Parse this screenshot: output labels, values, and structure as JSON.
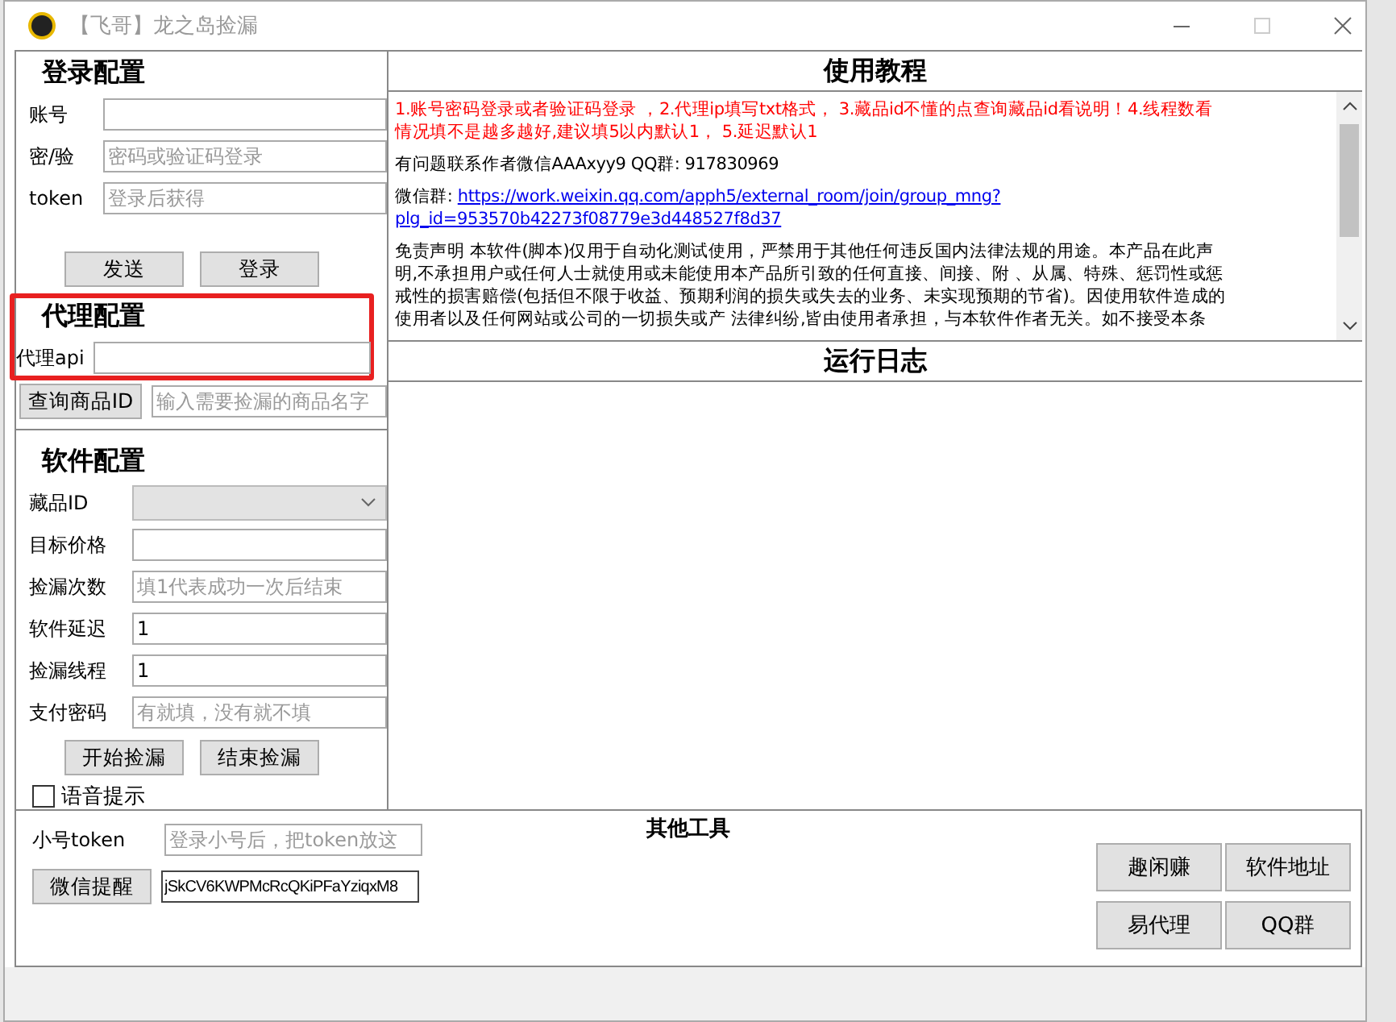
{
  "window": {
    "title": "【飞哥】龙之岛捡漏"
  },
  "login": {
    "heading": "登录配置",
    "fields": [
      {
        "label": "账号"
      },
      {
        "label": "密/验",
        "placeholder": "密码或验证码登录"
      },
      {
        "label": "token",
        "placeholder": "登录后获得"
      }
    ],
    "buttons": [
      "发送",
      "登录"
    ]
  },
  "proxy": {
    "heading": "代理配置",
    "highlighted": true,
    "label": "代理api"
  },
  "query": {
    "button": "查询商品ID",
    "placeholder": "输入需要捡漏的商品名字"
  },
  "software": {
    "heading": "软件配置",
    "fields": [
      {
        "label": "藏品ID",
        "kind": "select",
        "disabled": true
      },
      {
        "label": "目标价格",
        "kind": "input"
      },
      {
        "label": "捡漏次数",
        "kind": "input",
        "placeholder": "填1代表成功一次后结束"
      },
      {
        "label": "软件延迟",
        "kind": "input",
        "value": "1"
      },
      {
        "label": "捡漏线程",
        "kind": "input",
        "value": "1"
      },
      {
        "label": "支付密码",
        "kind": "input",
        "placeholder": "有就填，没有就不填"
      }
    ],
    "buttons": [
      "开始捡漏",
      "结束捡漏"
    ],
    "voice": {
      "label": "语音提示",
      "checked": false
    }
  },
  "tutorial": {
    "heading": "使用教程",
    "paragraphs": [
      {
        "kind": "notice",
        "lines": [
          "1.账号密码登录或者验证码登录 ，2.代理ip填写txt格式， 3.藏品id不懂的点查询藏品id看说明！4.线程数看",
          "情况填不是越多越好,建议填5以内默认1， 5.延迟默认1"
        ]
      },
      {
        "kind": "plain",
        "lines": [
          "有问题联系作者微信AAAxyy9 QQ群: 917830969"
        ]
      },
      {
        "kind": "link",
        "prefix": "微信群: ",
        "lines": [
          "https://work.weixin.qq.com/apph5/external_room/join/group_mng?",
          "plg_id=953570b42273f08779e3d448527f8d37"
        ]
      },
      {
        "kind": "plain",
        "lines": [
          "免责声明 本软件(脚本)仅用于自动化测试使用，严禁用于其他任何违反国内法律法规的用途。本产品在此声",
          "明,不承担用户或任何人士就使用或未能使用本产品所引致的任何直接、间接、附 、从属、特殊、惩罚性或惩",
          "戒性的损害赔偿(包括但不限于收益、预期利润的损失或失去的业务、未实现预期的节省)。因使用软件造成的",
          "使用者以及任何网站或公司的一切损失或产 法律纠纷,皆由使用者承担，与本软件作者无关。如不接受本条"
        ]
      }
    ]
  },
  "log": {
    "heading": "运行日志"
  },
  "tools": {
    "heading": "其他工具",
    "token_label": "小号token",
    "token_placeholder": "登录小号后，把token放这",
    "remind_button": "微信提醒",
    "remind_value": "jSkCV6KWPMcRcQKiPFaYziqxM8",
    "buttons": [
      "趣闲赚",
      "软件地址",
      "易代理",
      "QQ群"
    ]
  }
}
